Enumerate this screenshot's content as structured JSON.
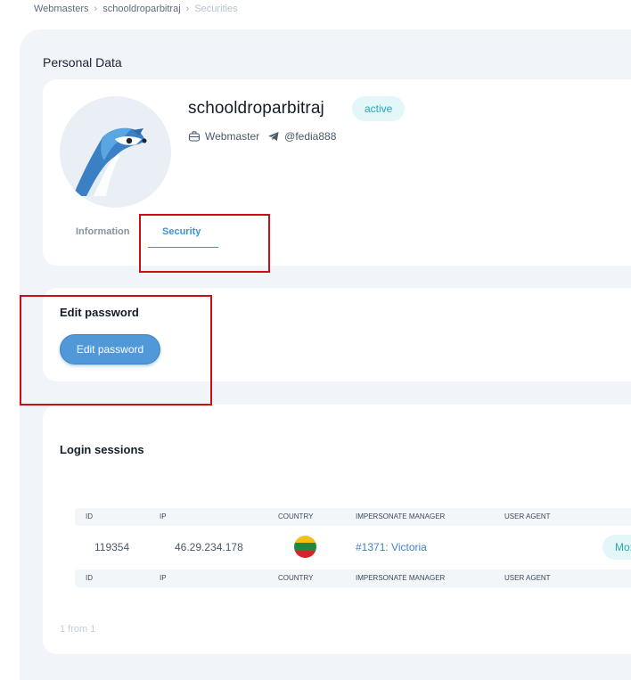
{
  "breadcrumb": {
    "items": [
      "Webmasters",
      "schooldroparbitraj",
      "Securities"
    ]
  },
  "section_title": "Personal Data",
  "profile": {
    "username": "schooldroparbitraj",
    "status": "active",
    "role": "Webmaster",
    "telegram": "@fedia888",
    "avatar_icon": "fennec-logo-icon"
  },
  "tabs": [
    {
      "label": "Information",
      "active": false
    },
    {
      "label": "Security",
      "active": true
    }
  ],
  "edit_password": {
    "title": "Edit password",
    "button_label": "Edit password"
  },
  "sessions": {
    "title": "Login sessions",
    "columns": [
      "ID",
      "IP",
      "COUNTRY",
      "IMPERSONATE MANAGER",
      "USER AGENT"
    ],
    "rows": [
      {
        "id": "119354",
        "ip": "46.29.234.178",
        "country_flag": "lithuania-flag-icon",
        "manager": "#1371: Victoria",
        "user_agent": "Mo:"
      }
    ],
    "pager_text": "1 from 1"
  },
  "colors": {
    "accent": "#3f93d3",
    "button": "#5198d9",
    "badge_bg": "#e3f6f8",
    "badge_text": "#2ba5b5",
    "panel_bg": "#f1f5f9",
    "annotation": "#cc0f17"
  }
}
